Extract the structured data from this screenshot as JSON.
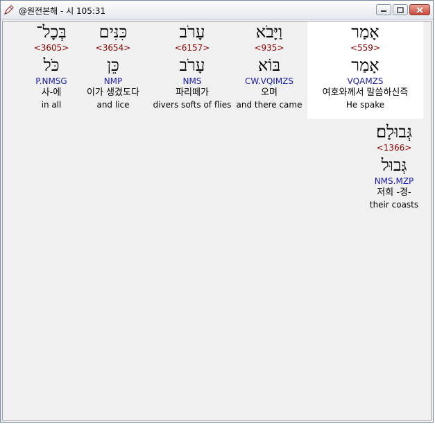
{
  "window": {
    "title": "@원전본해 - 시 105:31",
    "icon": "app-pen-icon"
  },
  "words": [
    {
      "hebrew": "אָמַר",
      "strong": "<559>",
      "lemma": "אָמַר",
      "morph": "VQAMZS",
      "korean": "여호와께서 말씀하신즉",
      "english": "He spake",
      "selected": true
    },
    {
      "hebrew": "וַיָּבֹא",
      "strong": "<935>",
      "lemma": "בּוֹא",
      "morph": "CW.VQIMZS",
      "korean": "오며",
      "english": "and there came"
    },
    {
      "hebrew": "עָרֹב",
      "strong": "<6157>",
      "lemma": "עָרֹב",
      "morph": "NMS",
      "korean": "파리떼가",
      "english": "divers softs of flies"
    },
    {
      "hebrew": "כִּנִּים",
      "strong": "<3654>",
      "lemma": "כֵּן",
      "morph": "NMP",
      "korean": "이가 생겼도다",
      "english": "and lice"
    },
    {
      "hebrew": "בְּכָל־",
      "strong": "<3605>",
      "lemma": "כֹּל",
      "morph": "P.NMSG",
      "korean": "사-에",
      "english": "in all"
    },
    {
      "hebrew": "גְּבוּלָם׃",
      "strong": "<1366>",
      "lemma": "גְּבוּל",
      "morph": "NMS.MZP",
      "korean": "저희 -경-",
      "english": "their coasts"
    }
  ]
}
